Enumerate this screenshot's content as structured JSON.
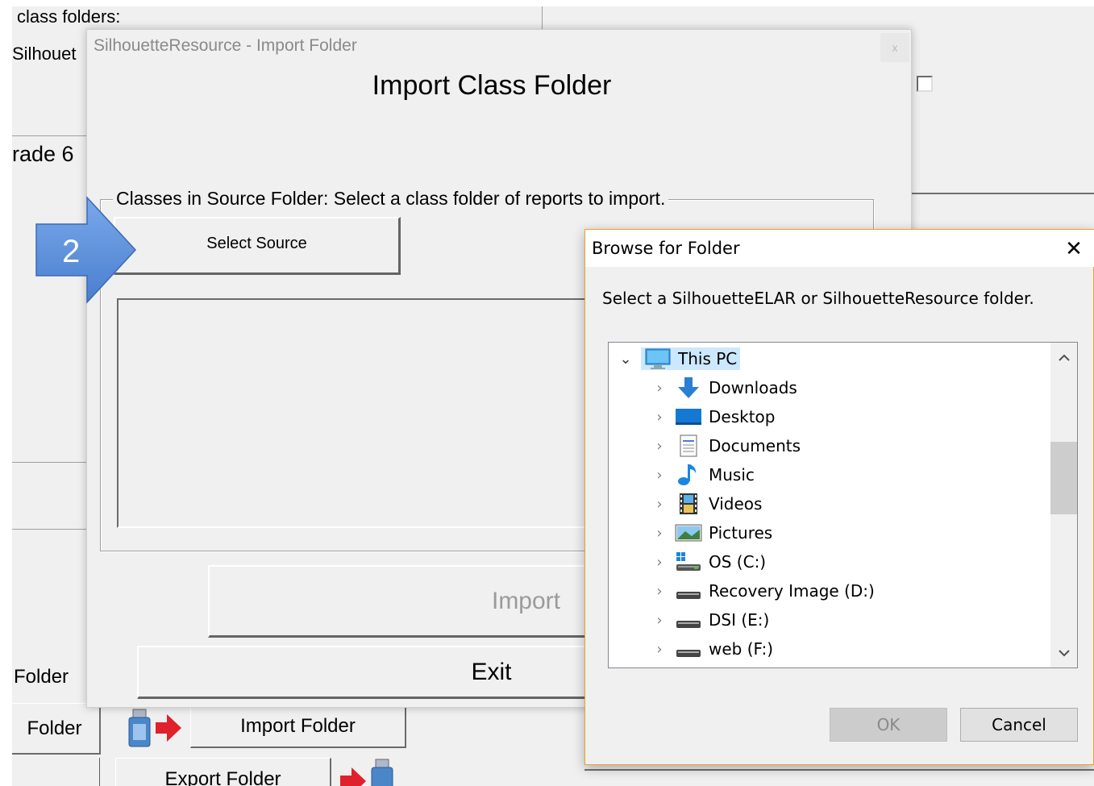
{
  "background_app": {
    "class_folders_label": "class folders:",
    "silhouette_text": "Silhouet",
    "grade_text": "rade 6",
    "folder_label_1": "Folder",
    "folder_label_2": "Folder",
    "import_folder_button": "Import Folder",
    "export_folder_button": "Export Folder"
  },
  "import_dialog": {
    "window_title": "SilhouetteResource - Import Folder",
    "close_glyph": "x",
    "heading": "Import Class Folder",
    "group_label": "Classes in Source Folder: Select a class folder of reports to import.",
    "select_source_button": "Select Source",
    "import_button": "Import",
    "exit_button": "Exit"
  },
  "callout": {
    "number": "2",
    "color": "#5b8fd9"
  },
  "browse_dialog": {
    "title": "Browse for Folder",
    "close_glyph": "✕",
    "instruction": "Select a SilhouetteELAR or SilhouetteResource folder.",
    "tree": {
      "root": {
        "label": "This PC",
        "icon": "computer-icon",
        "expanded": true,
        "selected": true
      },
      "items": [
        {
          "label": "Downloads",
          "icon": "downloads-icon"
        },
        {
          "label": "Desktop",
          "icon": "desktop-icon"
        },
        {
          "label": "Documents",
          "icon": "documents-icon"
        },
        {
          "label": "Music",
          "icon": "music-icon"
        },
        {
          "label": "Videos",
          "icon": "videos-icon"
        },
        {
          "label": "Pictures",
          "icon": "pictures-icon"
        },
        {
          "label": "OS (C:)",
          "icon": "windows-drive-icon"
        },
        {
          "label": "Recovery Image (D:)",
          "icon": "drive-icon"
        },
        {
          "label": "DSI (E:)",
          "icon": "drive-icon"
        },
        {
          "label": "web (F:)",
          "icon": "drive-icon"
        }
      ]
    },
    "ok_button": "OK",
    "cancel_button": "Cancel"
  }
}
